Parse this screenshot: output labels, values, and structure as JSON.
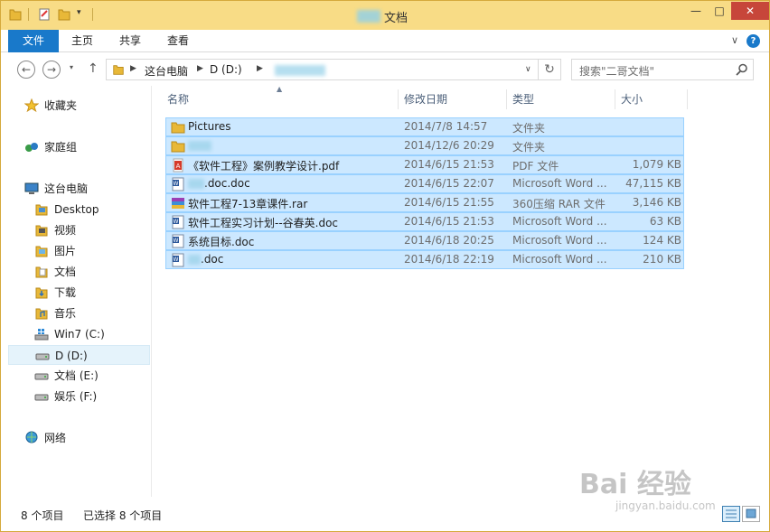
{
  "window": {
    "title": "文档",
    "controls": {
      "minimize": "—",
      "maximize": "□",
      "close": "✕"
    }
  },
  "ribbon": {
    "tabs": [
      "文件",
      "主页",
      "共享",
      "查看"
    ],
    "expand_icon": "chevron-down-icon",
    "help": "?"
  },
  "navigation": {
    "back": "←",
    "forward": "→",
    "recent": "▾",
    "up": "↑",
    "breadcrumb": [
      "这台电脑",
      "D (D:)"
    ],
    "address_dropdown": "∨",
    "refresh": "↻",
    "search_placeholder": "搜索\"二哥文档\""
  },
  "sidebar": {
    "items": [
      {
        "label": "收藏夹",
        "icon": "star-icon"
      },
      {
        "label": "家庭组",
        "icon": "homegroup-icon"
      },
      {
        "label": "这台电脑",
        "icon": "computer-icon"
      },
      {
        "label": "Desktop",
        "icon": "folder-icon"
      },
      {
        "label": "视频",
        "icon": "video-folder-icon"
      },
      {
        "label": "图片",
        "icon": "pictures-folder-icon"
      },
      {
        "label": "文档",
        "icon": "documents-folder-icon"
      },
      {
        "label": "下载",
        "icon": "downloads-folder-icon"
      },
      {
        "label": "音乐",
        "icon": "music-folder-icon"
      },
      {
        "label": "Win7 (C:)",
        "icon": "windows-drive-icon"
      },
      {
        "label": "D  (D:)",
        "icon": "drive-icon"
      },
      {
        "label": "文档 (E:)",
        "icon": "drive-icon"
      },
      {
        "label": "娱乐 (F:)",
        "icon": "drive-icon"
      },
      {
        "label": "网络",
        "icon": "network-icon"
      }
    ]
  },
  "columns": {
    "name": "名称",
    "date": "修改日期",
    "type": "类型",
    "size": "大小"
  },
  "files": [
    {
      "name": "Pictures",
      "date": "2014/7/8 14:57",
      "type": "文件夹",
      "size": "",
      "icon": "folder-icon"
    },
    {
      "name": "",
      "date": "2014/12/6 20:29",
      "type": "文件夹",
      "size": "",
      "icon": "folder-icon"
    },
    {
      "name": "《软件工程》案例教学设计.pdf",
      "date": "2014/6/15 21:53",
      "type": "PDF 文件",
      "size": "1,079 KB",
      "icon": "pdf-icon"
    },
    {
      "name": ".doc.doc",
      "date": "2014/6/15 22:07",
      "type": "Microsoft Word ...",
      "size": "47,115 KB",
      "icon": "word-doc-icon"
    },
    {
      "name": "软件工程7-13章课件.rar",
      "date": "2014/6/15 21:55",
      "type": "360压缩 RAR 文件",
      "size": "3,146 KB",
      "icon": "rar-archive-icon"
    },
    {
      "name": "软件工程实习计划--谷春英.doc",
      "date": "2014/6/15 21:53",
      "type": "Microsoft Word ...",
      "size": "63 KB",
      "icon": "word-doc-icon"
    },
    {
      "name": "系统目标.doc",
      "date": "2014/6/18 20:25",
      "type": "Microsoft Word ...",
      "size": "124 KB",
      "icon": "word-doc-icon"
    },
    {
      "name": ".doc",
      "date": "2014/6/18 22:19",
      "type": "Microsoft Word ...",
      "size": "210 KB",
      "icon": "word-doc-icon"
    }
  ],
  "status": {
    "count": "8 个项目",
    "selected": "已选择 8 个项目"
  },
  "watermark": {
    "text": "Bai 经验",
    "sub": "jingyan.baidu.com"
  },
  "colors": {
    "selection": "#cce8ff",
    "selection_border": "#99d1ff",
    "file_tab": "#1979ca",
    "title_bar": "#f8dc86"
  }
}
